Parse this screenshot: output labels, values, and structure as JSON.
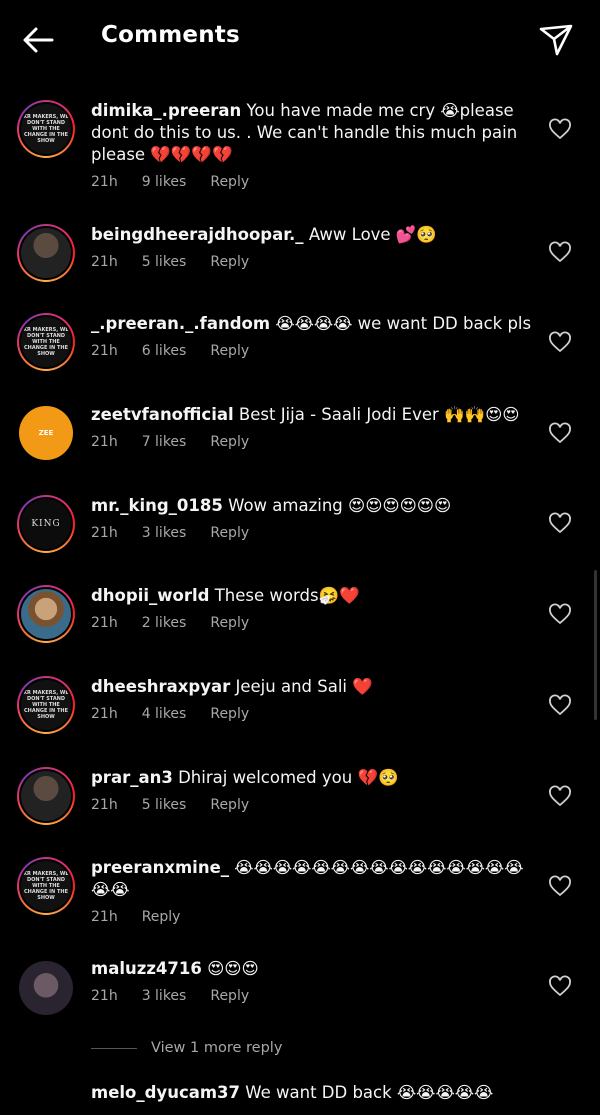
{
  "header": {
    "title": "Comments",
    "back_icon": "back-arrow-icon",
    "send_icon": "send-icon"
  },
  "comments": [
    {
      "username": "dimika_.preeran",
      "text": "You have made me cry 😭please dont do this to us. .  We can't handle this much pain please 💔💔💔💔",
      "time": "21h",
      "likes": "9 likes",
      "reply": "Reply",
      "avatar_text": "KR MAKERS, WE DON'T STAND WITH THE CHANGE IN THE SHOW"
    },
    {
      "username": "beingdheerajdhoopar._",
      "text": "Aww Love 💕🥺",
      "time": "21h",
      "likes": "5 likes",
      "reply": "Reply"
    },
    {
      "username": "_.preeran._.fandom",
      "text": "😭😭😭😭  we want DD back pls",
      "time": "21h",
      "likes": "6 likes",
      "reply": "Reply",
      "avatar_text": "KR MAKERS, WE DON'T STAND WITH THE CHANGE IN THE SHOW"
    },
    {
      "username": "zeetvfanofficial",
      "text": "Best Jija - Saali Jodi Ever 🙌🙌😍😍",
      "time": "21h",
      "likes": "7 likes",
      "reply": "Reply",
      "avatar_text": "ZEE"
    },
    {
      "username": "mr._king_0185",
      "text": "Wow amazing 😍😍😍😍😍😍",
      "time": "21h",
      "likes": "3 likes",
      "reply": "Reply",
      "avatar_text": "KING"
    },
    {
      "username": "dhopii_world",
      "text": "These words🤧❤️",
      "time": "21h",
      "likes": "2 likes",
      "reply": "Reply"
    },
    {
      "username": "dheeshraxpyar",
      "text": "Jeeju and Sali ❤️",
      "time": "21h",
      "likes": "4 likes",
      "reply": "Reply",
      "avatar_text": "KR MAKERS, WE DON'T STAND WITH THE CHANGE IN THE SHOW"
    },
    {
      "username": "prar_an3",
      "text": "Dhiraj welcomed you 💔🥺",
      "time": "21h",
      "likes": "5 likes",
      "reply": "Reply"
    },
    {
      "username": "preeranxmine_",
      "text": "😭😭😭😭😭😭😭😭😭😭😭😭😭😭😭😭😭",
      "time": "21h",
      "likes": "",
      "reply": "Reply",
      "avatar_text": "KR MAKERS, WE DON'T STAND WITH THE CHANGE IN THE SHOW"
    },
    {
      "username": "maluzz4716",
      "text": "😍😍😍",
      "time": "21h",
      "likes": "3 likes",
      "reply": "Reply"
    },
    {
      "username": "melo_dyucam37",
      "text": "We want DD back 😭😭😭😭😭"
    }
  ],
  "view_more": "View 1 more reply"
}
